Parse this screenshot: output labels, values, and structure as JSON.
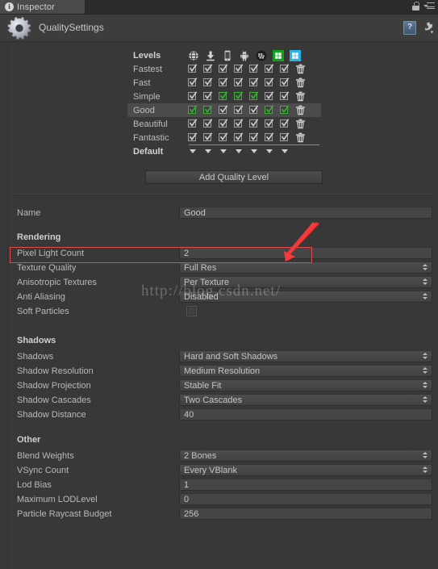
{
  "window": {
    "tab_label": "Inspector",
    "tab_icon": "info-icon",
    "lock_icon": "lock-icon",
    "menu_icon": "hamburger-menu-icon",
    "object_title": "QualitySettings",
    "object_icon": "gear-icon",
    "help_icon": "help-book-icon",
    "settings_icon": "gear-dropdown-icon"
  },
  "levels": {
    "header_label": "Levels",
    "default_label": "Default",
    "platform_icons": [
      "web-player-icon",
      "standalone-icon",
      "ios-icon",
      "android-icon",
      "blackberry-icon",
      "windows-store-icon",
      "windows-phone-icon"
    ],
    "delete_icon": "trash-icon",
    "rows": [
      {
        "name": "Fastest",
        "selected": false,
        "checks": [
          true,
          true,
          true,
          true,
          true,
          true,
          true
        ],
        "green": [
          false,
          false,
          false,
          false,
          false,
          false,
          false
        ]
      },
      {
        "name": "Fast",
        "selected": false,
        "checks": [
          true,
          true,
          true,
          true,
          true,
          true,
          true
        ],
        "green": [
          false,
          false,
          false,
          false,
          false,
          false,
          false
        ]
      },
      {
        "name": "Simple",
        "selected": false,
        "checks": [
          true,
          true,
          true,
          true,
          true,
          true,
          true
        ],
        "green": [
          false,
          false,
          true,
          true,
          true,
          false,
          false
        ]
      },
      {
        "name": "Good",
        "selected": true,
        "checks": [
          true,
          true,
          true,
          true,
          true,
          true,
          true
        ],
        "green": [
          true,
          true,
          false,
          false,
          false,
          true,
          true
        ]
      },
      {
        "name": "Beautiful",
        "selected": false,
        "checks": [
          true,
          true,
          true,
          true,
          true,
          true,
          true
        ],
        "green": [
          false,
          false,
          false,
          false,
          false,
          false,
          false
        ]
      },
      {
        "name": "Fantastic",
        "selected": false,
        "checks": [
          true,
          true,
          true,
          true,
          true,
          true,
          true
        ],
        "green": [
          false,
          false,
          false,
          false,
          false,
          false,
          false
        ]
      }
    ],
    "default_arrows": 7,
    "add_button_label": "Add Quality Level"
  },
  "name_row": {
    "label": "Name",
    "value": "Good"
  },
  "rendering": {
    "section_label": "Rendering",
    "rows": [
      {
        "label": "Pixel Light Count",
        "value": "2",
        "type": "number",
        "highlighted": true
      },
      {
        "label": "Texture Quality",
        "value": "Full Res",
        "type": "popup",
        "highlighted": false
      },
      {
        "label": "Anisotropic Textures",
        "value": "Per Texture",
        "type": "popup",
        "highlighted": false
      },
      {
        "label": "Anti Aliasing",
        "value": "Disabled",
        "type": "popup",
        "highlighted": false
      },
      {
        "label": "Soft Particles",
        "value": "",
        "type": "checkbox",
        "checked": false,
        "highlighted": false
      }
    ]
  },
  "shadows": {
    "section_label": "Shadows",
    "rows": [
      {
        "label": "Shadows",
        "value": "Hard and Soft Shadows",
        "type": "popup"
      },
      {
        "label": "Shadow Resolution",
        "value": "Medium Resolution",
        "type": "popup"
      },
      {
        "label": "Shadow Projection",
        "value": "Stable Fit",
        "type": "popup"
      },
      {
        "label": "Shadow Cascades",
        "value": "Two Cascades",
        "type": "popup"
      },
      {
        "label": "Shadow Distance",
        "value": "40",
        "type": "number"
      }
    ]
  },
  "other": {
    "section_label": "Other",
    "rows": [
      {
        "label": "Blend Weights",
        "value": "2 Bones",
        "type": "popup"
      },
      {
        "label": "VSync Count",
        "value": "Every VBlank",
        "type": "popup"
      },
      {
        "label": "Lod Bias",
        "value": "1",
        "type": "number"
      },
      {
        "label": "Maximum LODLevel",
        "value": "0",
        "type": "number"
      },
      {
        "label": "Particle Raycast Budget",
        "value": "256",
        "type": "number"
      }
    ]
  },
  "annotations": {
    "watermark": "http://blog.csdn.net/",
    "arrow_color": "#f03030",
    "highlight_color": "#e04b4b"
  }
}
